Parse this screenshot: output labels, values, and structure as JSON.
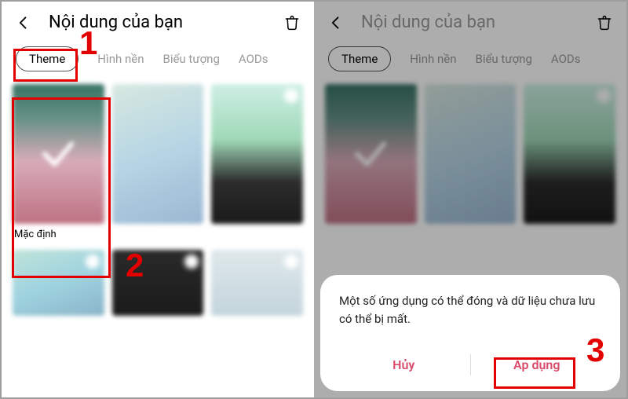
{
  "header": {
    "title": "Nội dung của bạn"
  },
  "tabs": {
    "theme": "Theme",
    "wallpaper": "Hình nền",
    "icons": "Biểu tượng",
    "aods": "AODs"
  },
  "themes": {
    "default_label": "Mặc định"
  },
  "dialog": {
    "message": "Một số ứng dụng có thể đóng và dữ liệu chưa lưu có thể bị mất.",
    "cancel": "Hủy",
    "apply": "Áp dụng"
  },
  "annotations": {
    "n1": "1",
    "n2": "2",
    "n3": "3"
  }
}
